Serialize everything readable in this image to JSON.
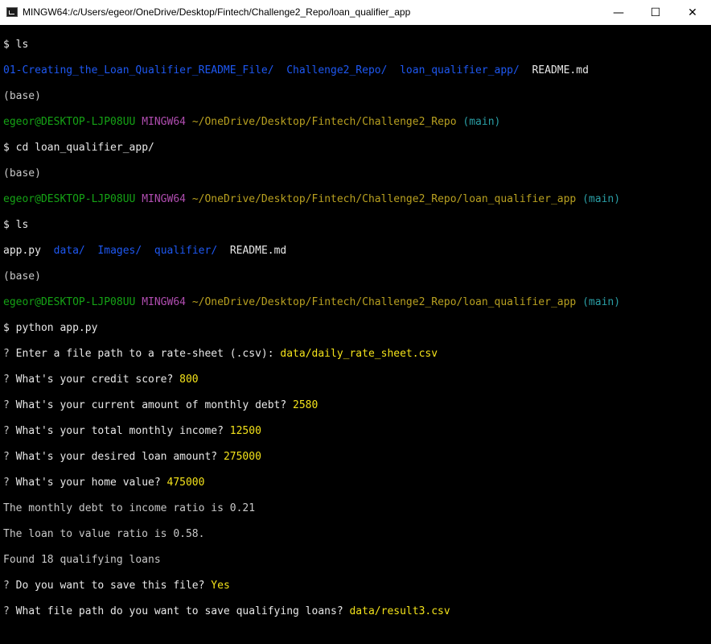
{
  "window": {
    "title": "MINGW64:/c/Users/egeor/OneDrive/Desktop/Fintech/Challenge2_Repo/loan_qualifier_app",
    "controls": {
      "minimize": "—",
      "maximize": "☐",
      "close": "✕"
    }
  },
  "terminal": {
    "prompt_symbol": "$",
    "question_mark": "?",
    "base_env": "(base)",
    "user_host": "egeor@DESKTOP-LJP08UU",
    "shell": "MINGW64",
    "branch": "(main)",
    "path_repo": "~/OneDrive/Desktop/Fintech/Challenge2_Repo",
    "path_app": "~/OneDrive/Desktop/Fintech/Challenge2_Repo/loan_qualifier_app",
    "cmd_ls": "ls",
    "cmd_cd": "cd loan_qualifier_app/",
    "cmd_python": "python app.py",
    "ls1": {
      "dir1": "01-Creating_the_Loan_Qualifier_README_File/",
      "dir2": "Challenge2_Repo/",
      "dir3": "loan_qualifier_app/",
      "file1": "README.md"
    },
    "ls2": {
      "file1": "app.py",
      "dir1": "data/",
      "dir2": "Images/",
      "dir3": "qualifier/",
      "file2": "README.md"
    },
    "q_rate_sheet": "Enter a file path to a rate-sheet (.csv):",
    "a_rate_sheet": "data/daily_rate_sheet.csv",
    "q_credit": "What's your credit score?",
    "a_credit": "800",
    "q_debt": "What's your current amount of monthly debt?",
    "a_debt": "2580",
    "q_income": "What's your total monthly income?",
    "a_income": "12500",
    "q_loan": "What's your desired loan amount?",
    "a_loan": "275000",
    "q_home": "What's your home value?",
    "a_home": "475000",
    "out_dti": "The monthly debt to income ratio is 0.21",
    "out_ltv": "The loan to value ratio is 0.58.",
    "out_found": "Found 18 qualifying loans",
    "q_save": "Do you want to save this file?",
    "a_save": "Yes",
    "q_path": "What file path do you want to save qualifying loans?",
    "a_path": "data/result3.csv"
  }
}
